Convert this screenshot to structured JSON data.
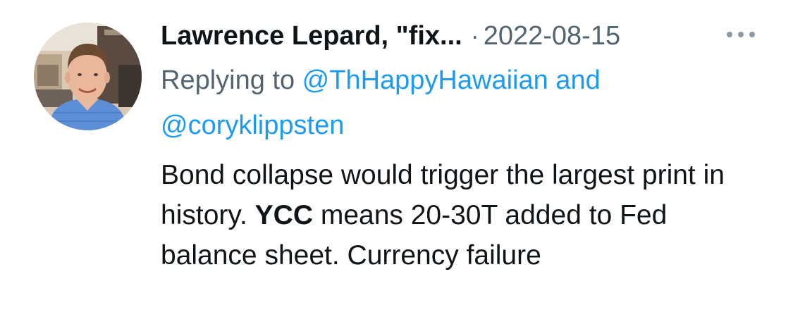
{
  "author": {
    "display_name": "Lawrence Lepard, \"fix...",
    "separator": "·",
    "timestamp": "2022-08-15"
  },
  "reply": {
    "prefix": "Replying to ",
    "mention_1": "@ThHappyHawaiian",
    "conjunction": " and",
    "mention_2": "@coryklippsten"
  },
  "tweet": {
    "part_1": "Bond collapse would trigger the largest print in history.  ",
    "bold": "YCC",
    "part_2": " means 20-30T added to Fed balance sheet.  Currency failure"
  },
  "icons": {
    "more": "more-horizontal-icon",
    "avatar": "profile-photo"
  },
  "colors": {
    "link": "#1d9bf0",
    "secondary_text": "#536471",
    "primary_text": "#0f1419",
    "more_dots": "#8b98a5"
  }
}
